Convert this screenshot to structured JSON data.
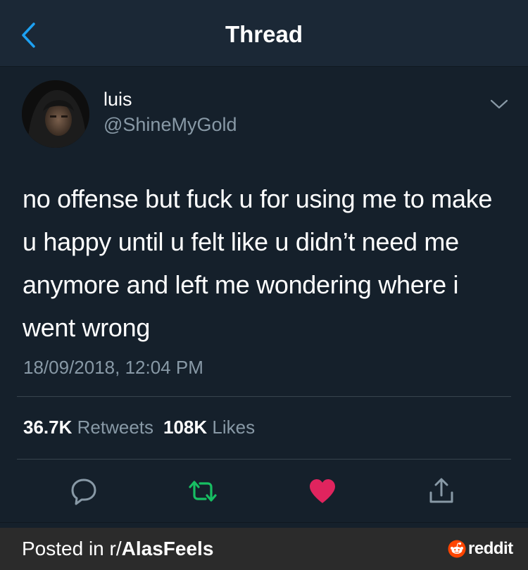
{
  "header": {
    "title": "Thread",
    "back_icon": "chevron-left-icon",
    "accent_color": "#1da1f2"
  },
  "tweet": {
    "display_name": "luis",
    "handle": "@ShineMyGold",
    "text": "no offense but fuck u for using me to make u happy until u felt like u didn’t need me anymore and left me wondering where i went wrong",
    "timestamp": "18/09/2018, 12:04 PM",
    "retweets_count": "36.7K",
    "retweets_label": "Retweets",
    "likes_count": "108K",
    "likes_label": "Likes",
    "liked": true
  },
  "actions": {
    "reply_icon": "reply-bubble-icon",
    "retweet_icon": "retweet-icon",
    "like_icon": "heart-icon",
    "share_icon": "share-icon"
  },
  "colors": {
    "background": "#15202b",
    "muted_text": "#8899a6",
    "retweet_green": "#17bf63",
    "like_pink": "#e0245e"
  },
  "footer": {
    "posted_in": "Posted in r/",
    "subreddit": "AlasFeels",
    "brand": "reddit"
  }
}
